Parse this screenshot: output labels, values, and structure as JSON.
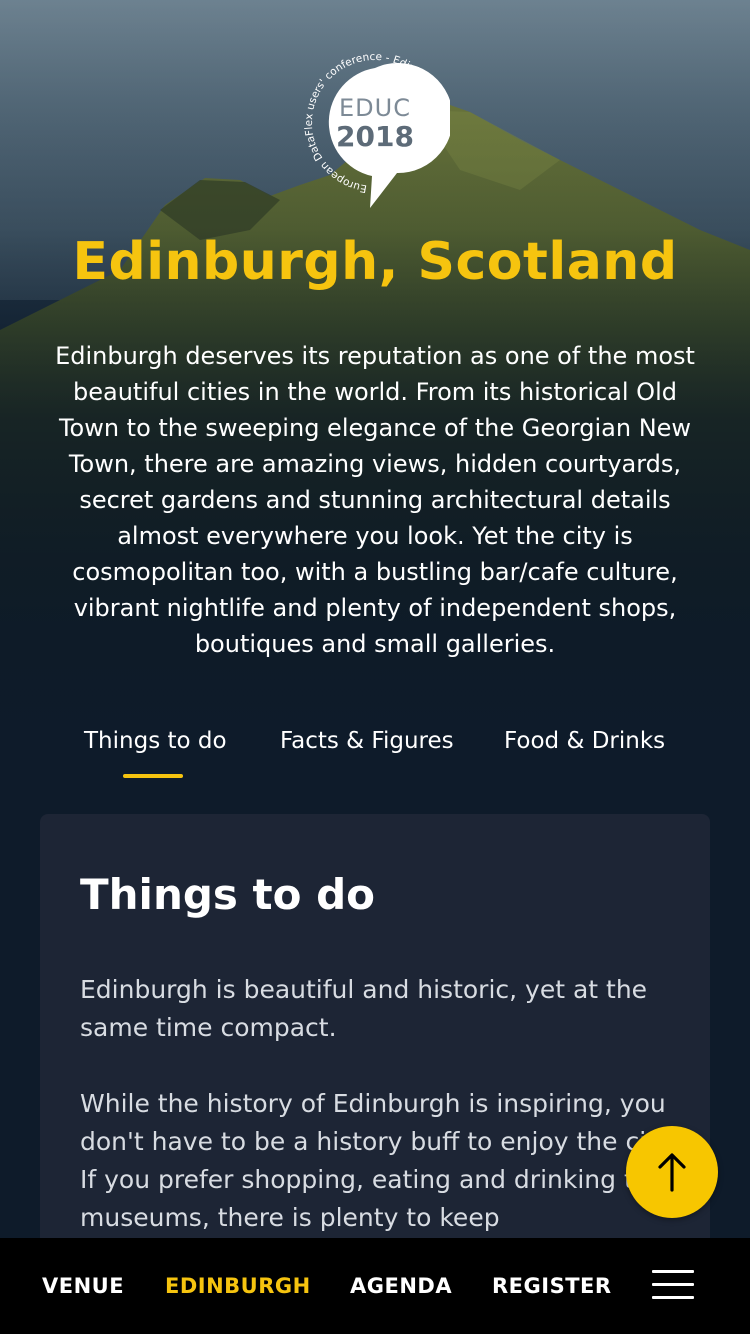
{
  "logo": {
    "ring_text": "European DataFlex users' conference - Edinburgh, Scotland",
    "name": "EDUC",
    "year": "2018"
  },
  "page": {
    "title": "Edinburgh, Scotland",
    "intro": "Edinburgh deserves its reputation as one of the most beautiful cities in the world. From its historical Old Town to the sweeping elegance of the Georgian New Town, there are amazing views, hidden courtyards, secret gardens and stunning architectural details almost everywhere you look. Yet the city is cosmopolitan too, with a bustling bar/cafe culture, vibrant nightlife and plenty of independent shops, boutiques and small galleries."
  },
  "tabs": [
    {
      "label": "Things to do",
      "active": true
    },
    {
      "label": "Facts & Figures",
      "active": false
    },
    {
      "label": "Food & Drinks",
      "active": false
    }
  ],
  "card": {
    "title": "Things to do",
    "paragraph1": "Edinburgh is beautiful and historic, yet at the same time compact.",
    "paragraph2": "While the history of Edinburgh is inspiring, you don't have to be a history buff to enjoy the city. If you prefer shopping, eating and drinking to museums, there is plenty to keep"
  },
  "scroll_top": {
    "icon": "arrow-up-icon"
  },
  "bottom_nav": {
    "items": [
      {
        "label": "VENUE",
        "active": false
      },
      {
        "label": "EDINBURGH",
        "active": true
      },
      {
        "label": "AGENDA",
        "active": false
      },
      {
        "label": "REGISTER",
        "active": false
      }
    ],
    "menu_icon": "hamburger-menu-icon"
  },
  "colors": {
    "accent": "#f6c40f",
    "background": "#0e1b2a",
    "card": "#1d2535",
    "nav": "#000000"
  }
}
